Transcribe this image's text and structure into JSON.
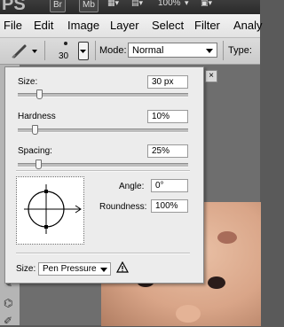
{
  "titlebar": {
    "app_badge": "PS",
    "bridge_badge": "Br",
    "minibridge_badge": "Mb",
    "zoom": "100%"
  },
  "menu": {
    "items": [
      "File",
      "Edit",
      "Image",
      "Layer",
      "Select",
      "Filter",
      "Analy"
    ]
  },
  "options_bar": {
    "brush_size": "30",
    "mode_label": "Mode:",
    "mode_value": "Normal",
    "type_label": "Type:"
  },
  "brush_panel": {
    "size_label": "Size:",
    "size_value": "30 px",
    "size_level": 0.13,
    "hardness_label": "Hardness",
    "hardness_value": "10%",
    "hardness_level": 0.1,
    "spacing_label": "Spacing:",
    "spacing_value": "25%",
    "spacing_level": 0.12,
    "angle_label": "Angle:",
    "angle_value": "0°",
    "roundness_label": "Roundness:",
    "roundness_value": "100%",
    "pressure_label": "Size:",
    "pressure_value": "Pen Pressure",
    "warning_icon": "warning-icon"
  },
  "document": {
    "close_glyph": "×"
  },
  "colors": {
    "panel_bg": "#ececec",
    "menubar_bg": "#e8e8e8",
    "titlebar_bg": "#333333"
  }
}
